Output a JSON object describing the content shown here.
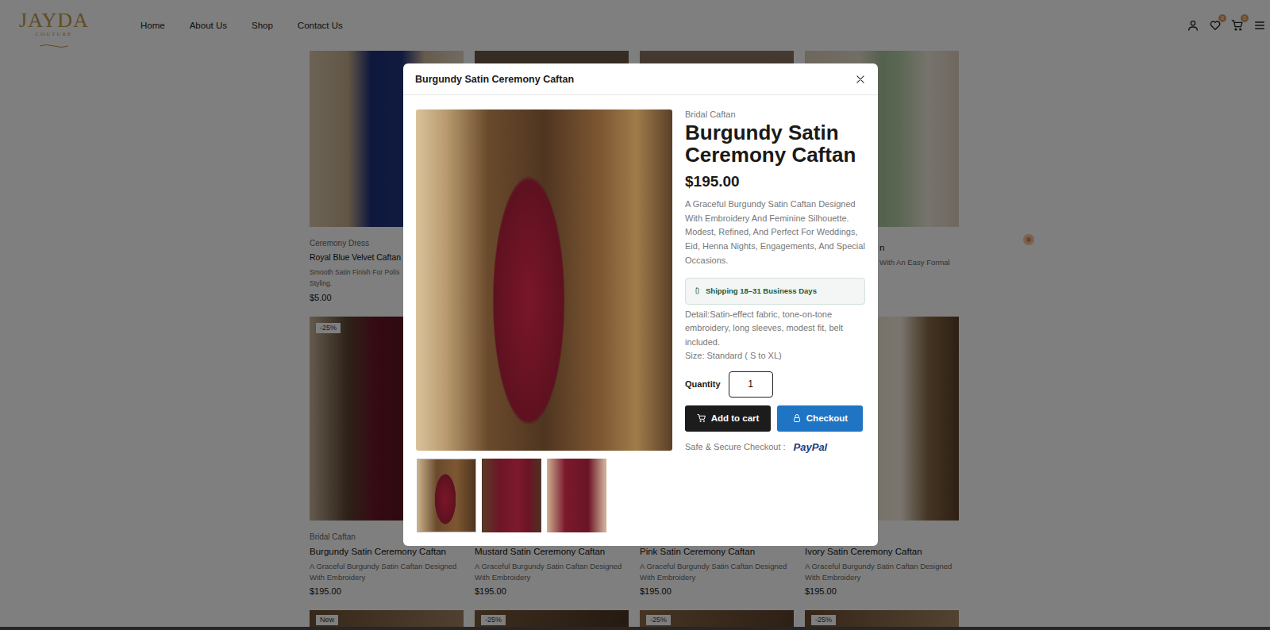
{
  "header": {
    "logo": {
      "name": "JAYDA",
      "tagline": "COUTURE"
    },
    "nav": [
      {
        "label": "Home"
      },
      {
        "label": "About Us"
      },
      {
        "label": "Shop"
      },
      {
        "label": "Contact Us"
      }
    ],
    "wishlist_count": "0",
    "cart_count": "0"
  },
  "product_rows": [
    [
      {
        "kind": "left-part",
        "category": "Ceremony Dress",
        "title": "Royal Blue Velvet Caftan",
        "description": [
          "Smooth Satin Finish For Polis",
          "Styling."
        ],
        "price": "$5.00"
      },
      {
        "kind": "hidden"
      },
      {
        "kind": "hidden"
      },
      {
        "kind": "right-part",
        "title": "n",
        "description": [
          "With An Easy Formal"
        ]
      }
    ],
    [
      {
        "kind": "full",
        "badge": "-25%",
        "category": "Bridal Caftan",
        "title": "Burgundy Satin Ceremony Caftan",
        "description": [
          "A Graceful Burgundy Satin Caftan Designed",
          "With Embroidery"
        ],
        "price": "$195.00"
      },
      {
        "kind": "no-category",
        "title": "Mustard Satin Ceremony Caftan",
        "description": [
          "A Graceful Burgundy Satin Caftan Designed",
          "With Embroidery"
        ],
        "price": "$195.00"
      },
      {
        "kind": "no-category",
        "title": "Pink Satin Ceremony Caftan",
        "description": [
          "A Graceful Burgundy Satin Caftan Designed",
          "With Embroidery"
        ],
        "price": "$195.00"
      },
      {
        "kind": "no-category",
        "title": "Ivory Satin Ceremony Caftan",
        "description": [
          "A Graceful Burgundy Satin Caftan Designed",
          "With Embroidery"
        ],
        "price": "$195.00"
      }
    ],
    [
      {
        "kind": "image-only",
        "badge": "New"
      },
      {
        "kind": "image-only",
        "badge": "-25%"
      },
      {
        "kind": "image-only",
        "badge": "-25%"
      },
      {
        "kind": "image-only",
        "badge": "-25%"
      }
    ]
  ],
  "modal": {
    "title": "Burgundy Satin Ceremony Caftan",
    "thumbnails": [
      {
        "selected": true
      },
      {
        "selected": false
      },
      {
        "selected": false
      }
    ],
    "product": {
      "category": "Bridal Caftan",
      "name": "Burgundy Satin Ceremony Caftan",
      "price": "$195.00",
      "description": "A Graceful Burgundy Satin Caftan Designed With Embroidery And Feminine Silhouette. Modest, Refined, And Perfect For Weddings, Eid, Henna Nights, Engagements, And Special Occasions.",
      "shipping": "Shipping 18–31 Business Days",
      "detail": "Detail:Satin-effect fabric, tone-on-tone embroidery, long sleeves, modest fit, belt included.",
      "size": "Size: Standard ( S to XL)"
    },
    "quantity": {
      "label": "Quantity",
      "value": "1"
    },
    "buttons": [
      {
        "label": "Add to cart",
        "kind": "cart"
      },
      {
        "label": "Checkout",
        "kind": "checkout"
      }
    ],
    "secure": {
      "label": "Safe & Secure Checkout :",
      "brand": "PayPal"
    }
  }
}
